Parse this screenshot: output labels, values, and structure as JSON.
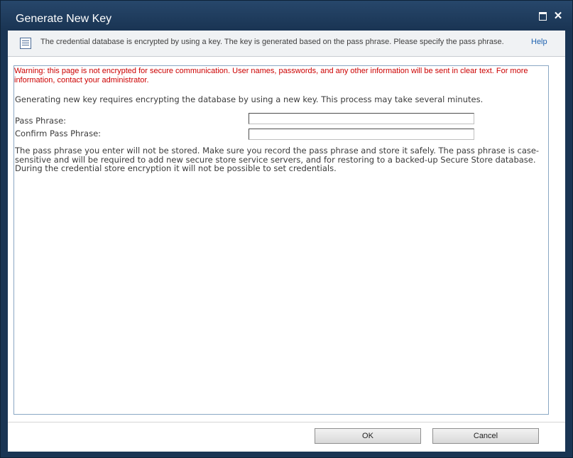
{
  "window": {
    "title": "Generate New Key"
  },
  "infobar": {
    "text": "The credential database is encrypted by using a key. The key is generated based on the pass phrase. Please specify the pass phrase.",
    "help": "Help"
  },
  "form": {
    "warning": "Warning: this page is not encrypted for secure communication. User names, passwords, and any other information will be sent in clear text. For more information, contact your administrator.",
    "intro": "Generating new key requires encrypting the database by using a new key. This process may take several minutes.",
    "pass_phrase_label": "Pass Phrase:",
    "pass_phrase_value": "",
    "confirm_label": "Confirm Pass Phrase:",
    "confirm_value": "",
    "note": "The pass phrase you enter will not be stored. Make sure you record the pass phrase and store it safely. The pass phrase is case-sensitive and will be required to add new secure store service servers, and for restoring to a backed-up Secure Store database. During the credential store encryption it will not be possible to set credentials."
  },
  "buttons": {
    "ok": "OK",
    "cancel": "Cancel"
  },
  "icons": {
    "maximize": "maximize-icon",
    "close": "close-icon",
    "info": "list-page-icon"
  }
}
